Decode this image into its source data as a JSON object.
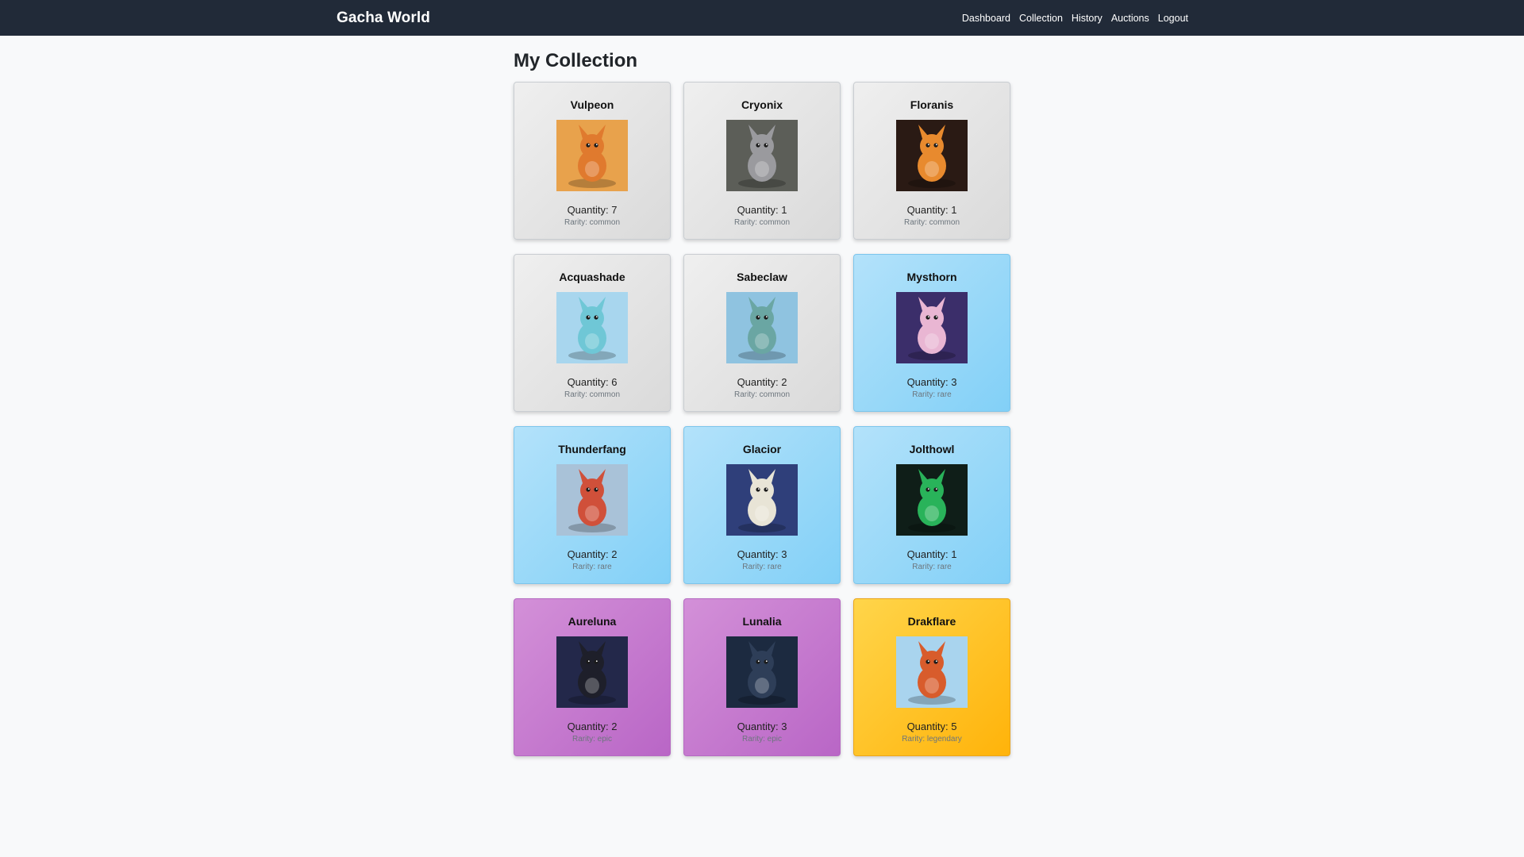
{
  "nav": {
    "brand": "Gacha World",
    "links": [
      "Dashboard",
      "Collection",
      "History",
      "Auctions",
      "Logout"
    ]
  },
  "page": {
    "title": "My Collection"
  },
  "cards": [
    {
      "name": "Vulpeon",
      "quantity": "Quantity: 7",
      "rarity": "Rarity: common",
      "tier": "common",
      "icon": "fox-creature-image",
      "bg": "#e8a24c",
      "body": "#e07a2e"
    },
    {
      "name": "Cryonix",
      "quantity": "Quantity: 1",
      "rarity": "Rarity: common",
      "tier": "common",
      "icon": "gray-dragon-creature-image",
      "bg": "#5c5e58",
      "body": "#9a9a9e"
    },
    {
      "name": "Floranis",
      "quantity": "Quantity: 1",
      "rarity": "Rarity: common",
      "tier": "common",
      "icon": "fire-creature-image",
      "bg": "#2a1a14",
      "body": "#e88a2e"
    },
    {
      "name": "Acquashade",
      "quantity": "Quantity: 6",
      "rarity": "Rarity: common",
      "tier": "common",
      "icon": "water-creature-image",
      "bg": "#a8d6ee",
      "body": "#6fc7d6"
    },
    {
      "name": "Sabeclaw",
      "quantity": "Quantity: 2",
      "rarity": "Rarity: common",
      "tier": "common",
      "icon": "teal-creature-image",
      "bg": "#8fc3e0",
      "body": "#6aa6a3"
    },
    {
      "name": "Mysthorn",
      "quantity": "Quantity: 3",
      "rarity": "Rarity: rare",
      "tier": "rare",
      "icon": "psychic-creature-image",
      "bg": "#3b2e6a",
      "body": "#e9b6d3"
    },
    {
      "name": "Thunderfang",
      "quantity": "Quantity: 2",
      "rarity": "Rarity: rare",
      "tier": "rare",
      "icon": "red-dragon-creature-image",
      "bg": "#a9c2d8",
      "body": "#d0503a"
    },
    {
      "name": "Glacior",
      "quantity": "Quantity: 3",
      "rarity": "Rarity: rare",
      "tier": "rare",
      "icon": "ice-creature-image",
      "bg": "#2f3f7a",
      "body": "#e8e4d6"
    },
    {
      "name": "Jolthowl",
      "quantity": "Quantity: 1",
      "rarity": "Rarity: rare",
      "tier": "rare",
      "icon": "green-electric-creature-image",
      "bg": "#0f1e18",
      "body": "#29b35a"
    },
    {
      "name": "Aureluna",
      "quantity": "Quantity: 2",
      "rarity": "Rarity: epic",
      "tier": "epic",
      "icon": "dark-dragon-creature-image",
      "bg": "#23284a",
      "body": "#1e1f2a"
    },
    {
      "name": "Lunalia",
      "quantity": "Quantity: 3",
      "rarity": "Rarity: epic",
      "tier": "epic",
      "icon": "night-creature-image",
      "bg": "#1c2a40",
      "body": "#2e3e58"
    },
    {
      "name": "Drakflare",
      "quantity": "Quantity: 5",
      "rarity": "Rarity: legendary",
      "tier": "legendary",
      "icon": "orange-dragon-creature-image",
      "bg": "#a9d4ee",
      "body": "#d85c2c"
    }
  ]
}
